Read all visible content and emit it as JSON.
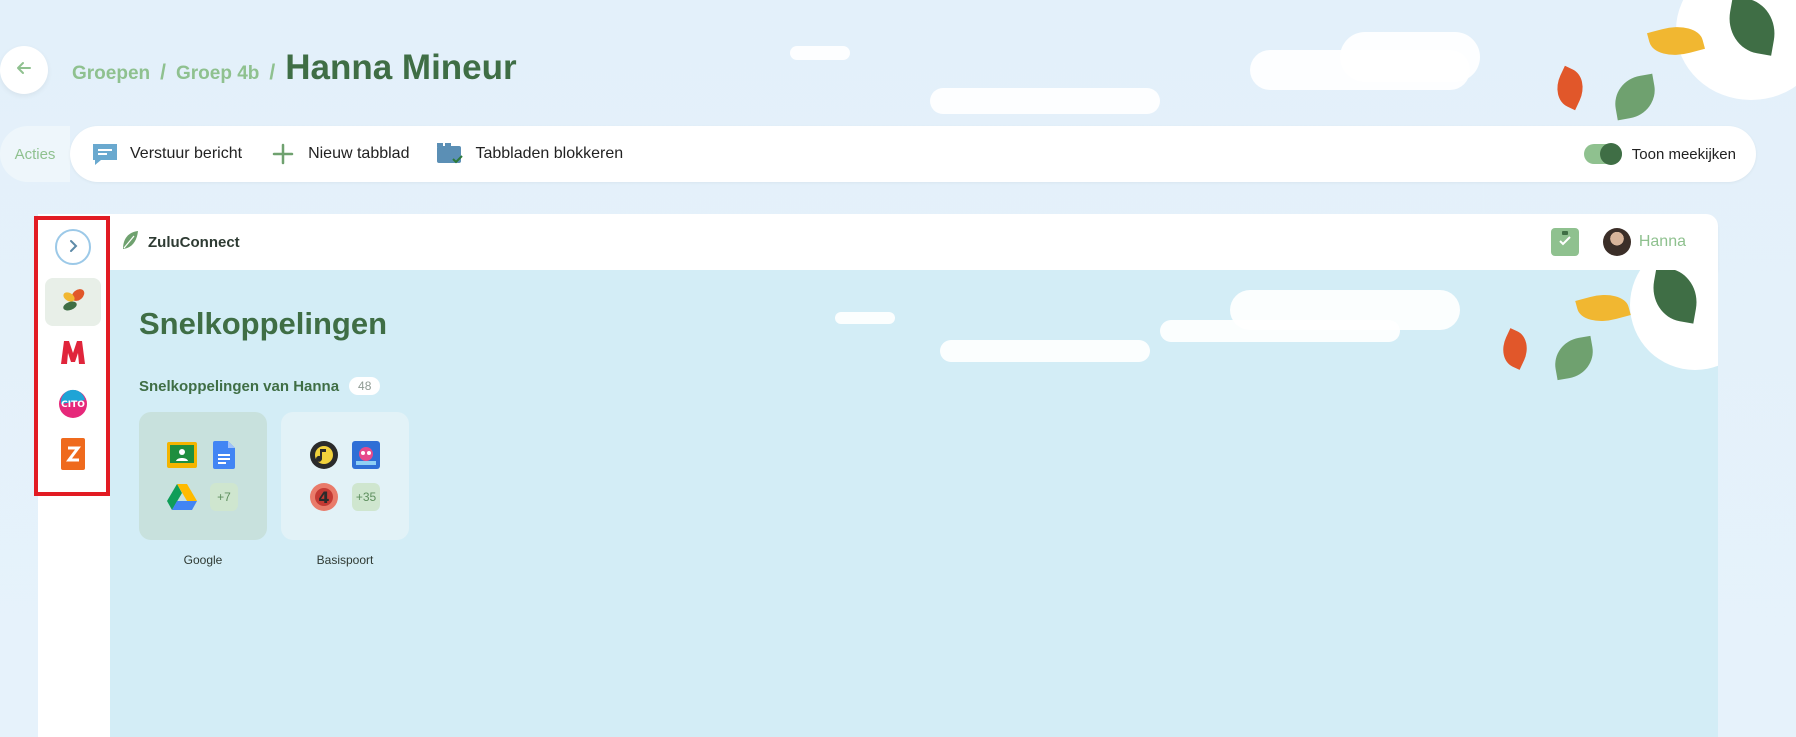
{
  "breadcrumb": {
    "items": [
      "Groepen",
      "Groep 4b"
    ],
    "separator": "/",
    "current": "Hanna Mineur"
  },
  "actions": {
    "label": "Acties",
    "send_message": "Verstuur bericht",
    "new_tab": "Nieuw tabblad",
    "block_tabs": "Tabbladen blokkeren",
    "toggle_label": "Toon meekijken",
    "toggle_on": true
  },
  "browser": {
    "brand": "ZuluConnect",
    "user_name": "Hanna"
  },
  "sidebar": {
    "apps": [
      "zuluconnect-icon",
      "malmberg-icon",
      "cito-icon",
      "zulu-z-icon"
    ]
  },
  "content": {
    "title": "Snelkoppelingen",
    "section_title": "Snelkoppelingen van Hanna",
    "section_count": "48",
    "tiles": [
      {
        "label": "Google",
        "more": "+7"
      },
      {
        "label": "Basispoort",
        "more": "+35"
      }
    ]
  },
  "colors": {
    "brand_green": "#3f6e45",
    "light_green": "#8fc18f",
    "highlight_red": "#e21b23",
    "content_bg": "#d3edf6"
  }
}
